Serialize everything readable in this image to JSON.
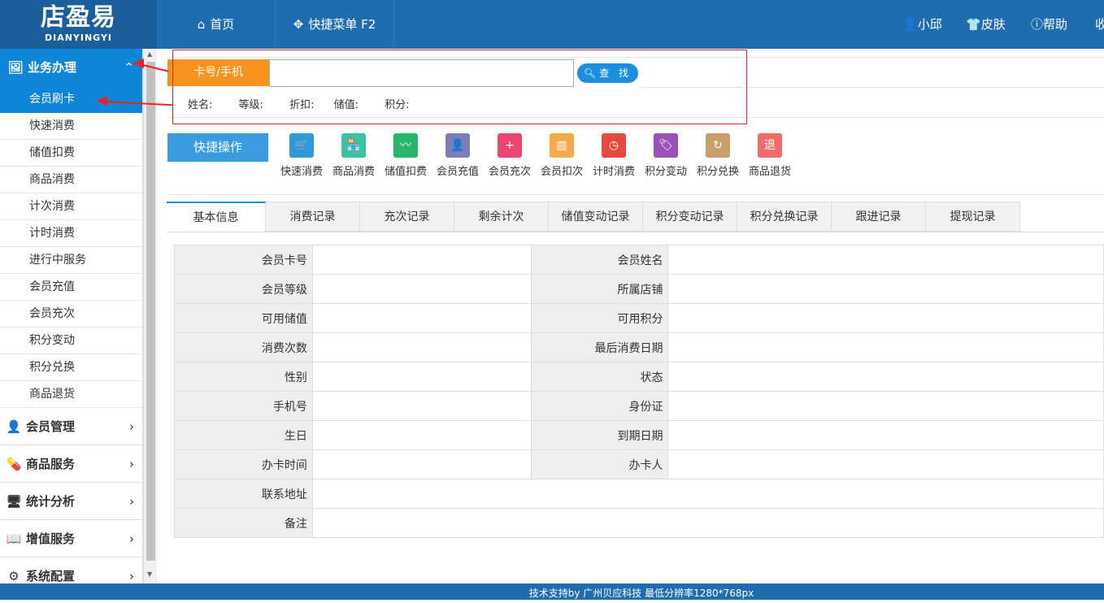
{
  "logo": {
    "title": "店盈易",
    "subtitle": "DIANYINGYI"
  },
  "topnav": {
    "home": "首页",
    "quick_menu": "快捷菜单 F2"
  },
  "topright": {
    "user": "小邱",
    "skin": "皮肤",
    "help": "帮助",
    "more": "收"
  },
  "sidebar": {
    "active_section": "业务办理",
    "sub_items": [
      "会员刷卡",
      "快速消费",
      "储值扣费",
      "商品消费",
      "计次消费",
      "计时消费",
      "进行中服务",
      "会员充值",
      "会员充次",
      "积分变动",
      "积分兑换",
      "商品退货"
    ],
    "sections": [
      "会员管理",
      "商品服务",
      "统计分析",
      "增值服务",
      "系统配置"
    ]
  },
  "search": {
    "card_label": "卡号/手机",
    "input_value": "",
    "button": "查 找"
  },
  "info": {
    "name": "姓名:",
    "level": "等级:",
    "discount": "折扣:",
    "balance": "储值:",
    "points": "积分:"
  },
  "quick": {
    "title": "快捷操作",
    "items": [
      {
        "label": "快速消费",
        "icon": "cart-icon",
        "color": "#2e9ad8"
      },
      {
        "label": "商品消费",
        "icon": "shop-icon",
        "color": "#3ac3a2"
      },
      {
        "label": "储值扣费",
        "icon": "chart-icon",
        "color": "#28b66a"
      },
      {
        "label": "会员充值",
        "icon": "user-money-icon",
        "color": "#7b7fb8"
      },
      {
        "label": "会员充次",
        "icon": "card-plus-icon",
        "color": "#e9476e"
      },
      {
        "label": "会员扣次",
        "icon": "bar-chart-icon",
        "color": "#f4a94a"
      },
      {
        "label": "计时消费",
        "icon": "clock-icon",
        "color": "#e64a3d"
      },
      {
        "label": "积分变动",
        "icon": "tag-icon",
        "color": "#9a52b8"
      },
      {
        "label": "积分兑换",
        "icon": "refresh-icon",
        "color": "#c9a06c"
      },
      {
        "label": "商品退货",
        "icon": "return-icon",
        "color": "#f26b6b"
      }
    ]
  },
  "tabs": [
    "基本信息",
    "消费记录",
    "充次记录",
    "剩余计次",
    "储值变动记录",
    "积分变动记录",
    "积分兑换记录",
    "跟进记录",
    "提现记录"
  ],
  "detail": {
    "rows": [
      [
        "会员卡号",
        "会员姓名"
      ],
      [
        "会员等级",
        "所属店铺"
      ],
      [
        "可用储值",
        "可用积分"
      ],
      [
        "消费次数",
        "最后消费日期"
      ],
      [
        "性别",
        "状态"
      ],
      [
        "手机号",
        "身份证"
      ],
      [
        "生日",
        "到期日期"
      ],
      [
        "办卡时间",
        "办卡人"
      ]
    ],
    "address": "联系地址",
    "remark": "备注"
  },
  "footer": "技术支持by 广州贝应科技    最低分辨率1280*768px"
}
